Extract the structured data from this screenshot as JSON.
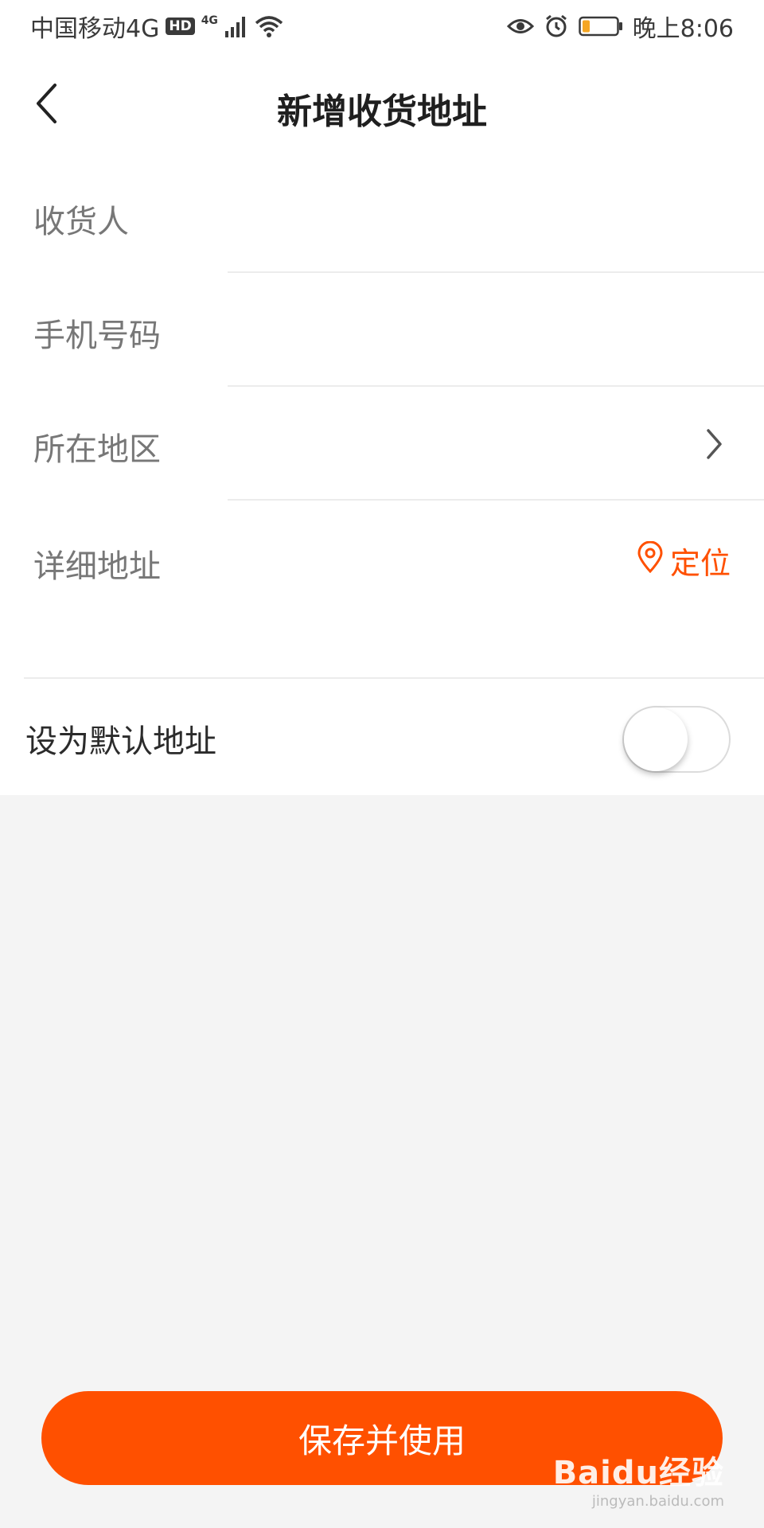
{
  "status_bar": {
    "carrier": "中国移动4G",
    "hd": "HD",
    "network": "4G",
    "time": "晚上8:06",
    "icons": [
      "signal-icon",
      "wifi-icon",
      "eye-icon",
      "alarm-icon",
      "battery-icon"
    ],
    "battery_color": "#f5a623"
  },
  "header": {
    "title": "新增收货地址",
    "back_icon": "chevron-left-icon"
  },
  "form": {
    "recipient": {
      "label": "收货人",
      "value": "",
      "placeholder": ""
    },
    "phone": {
      "label": "手机号码",
      "value": "",
      "placeholder": ""
    },
    "region": {
      "label": "所在地区",
      "value": ""
    },
    "address": {
      "label": "详细地址",
      "value": "",
      "locate_label": "定位"
    },
    "default": {
      "label": "设为默认地址",
      "enabled": false
    }
  },
  "save_button": {
    "label": "保存并使用"
  },
  "watermark": {
    "main": "Baidu经验",
    "sub": "jingyan.baidu.com"
  },
  "colors": {
    "accent": "#ff5000",
    "background": "#f4f4f4"
  }
}
